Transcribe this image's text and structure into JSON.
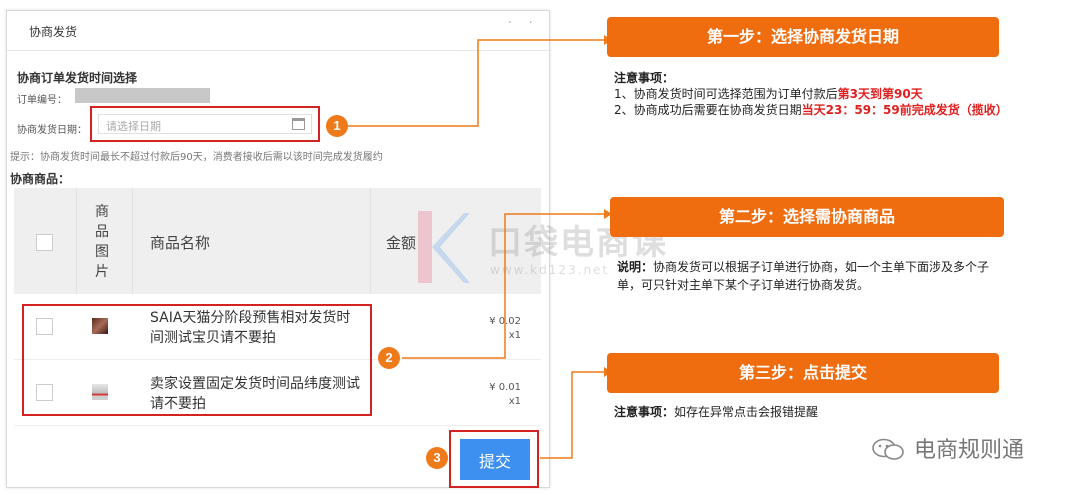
{
  "dialog": {
    "title": "协商发货",
    "close_icon": "close-dots-icon",
    "section_title": "协商订单发货时间选择",
    "order_label": "订单编号：",
    "date_label": "协商发货日期：",
    "date_placeholder": "请选择日期",
    "tip": "提示：协商发货时间最长不超过付款后90天，消费者接收后需以该时间完成发货履约",
    "goods_title": "协商商品：",
    "table": {
      "headers": [
        "商品图片",
        "商品名称",
        "金额"
      ],
      "header_img_chars": [
        "商",
        "品",
        "图",
        "片"
      ],
      "rows": [
        {
          "name": "SAIA天猫分阶段预售相对发货时间测试宝贝请不要拍",
          "price": "¥ 0.02",
          "qty": "x1"
        },
        {
          "name": "卖家设置固定发货时间品纬度测试请不要拍",
          "price": "¥ 0.01",
          "qty": "x1"
        }
      ]
    },
    "submit_label": "提交"
  },
  "badges": [
    "1",
    "2",
    "3"
  ],
  "steps": [
    {
      "title": "第一步：选择协商发货日期",
      "note_heading": "注意事项：",
      "line1_prefix": "1、协商发货时间可选择范围为订单付款后",
      "line1_highlight": "第3天到第90天",
      "line2_prefix": "2、协商成功后需要在协商发货日期",
      "line2_highlight": "当天23：59：59前完成发货（揽收）"
    },
    {
      "title": "第二步：选择需协商商品",
      "note_heading": "说明：",
      "note_text": "协商发货可以根据子订单进行协商，如一个主单下面涉及多个子单，可只针对主单下某个子订单进行协商发货。"
    },
    {
      "title": "第三步：点击提交",
      "note_heading": "注意事项：",
      "note_text": "如存在异常点击会报错提醒"
    }
  ],
  "watermark": {
    "text": "口袋电商课",
    "url": "www.kd123.net"
  },
  "brand": {
    "icon": "wechat-icon",
    "text": "电商规则通"
  },
  "colors": {
    "accent_orange": "#ef6c0f",
    "highlight_red": "#e02020",
    "submit_blue": "#3d8ff0",
    "box_red": "#d22222"
  }
}
